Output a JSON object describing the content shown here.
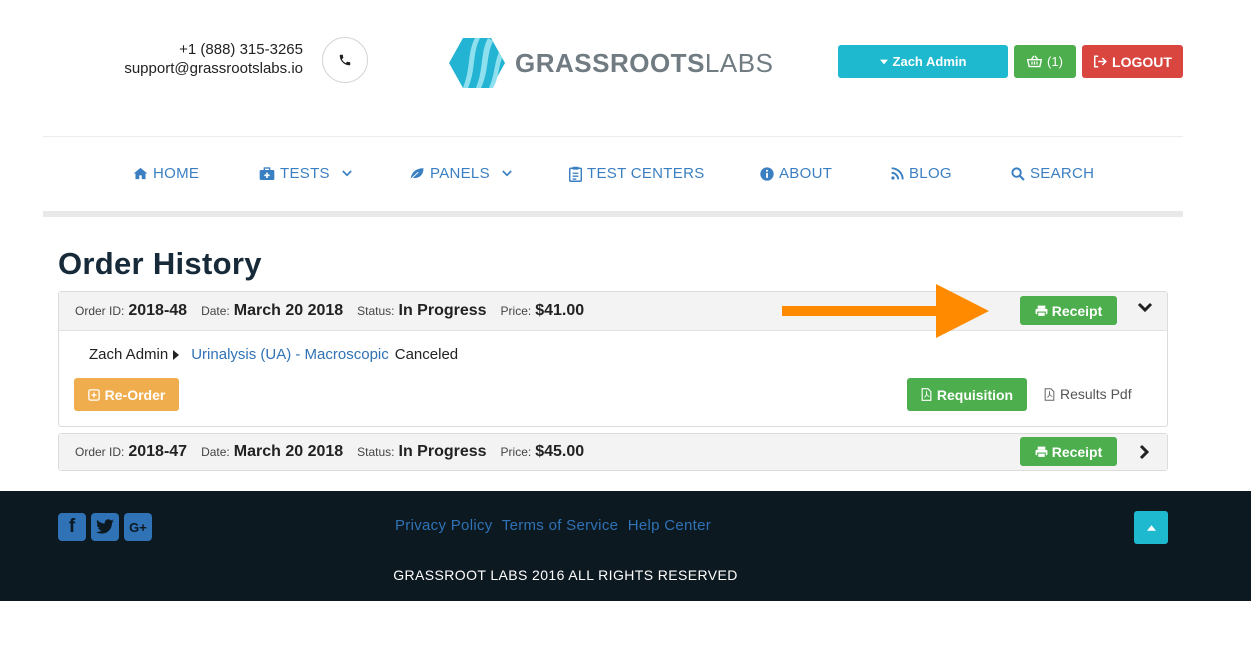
{
  "header": {
    "phone": "+1 (888) 315-3265",
    "email": "support@grassrootslabs.io",
    "logo_bold": "GRASSROOTS",
    "logo_light": "LABS",
    "admin_label": "Zach Admin",
    "cart_label": "(1)",
    "logout_label": "LOGOUT"
  },
  "nav": {
    "items": [
      {
        "label": "HOME",
        "icon": "home-icon"
      },
      {
        "label": "TESTS",
        "icon": "medkit-icon"
      },
      {
        "label": "PANELS",
        "icon": "leaf-icon"
      },
      {
        "label": "TEST CENTERS",
        "icon": "clipboard-icon"
      },
      {
        "label": "ABOUT",
        "icon": "info-icon"
      },
      {
        "label": "BLOG",
        "icon": "rss-icon"
      },
      {
        "label": "SEARCH",
        "icon": "search-icon"
      }
    ]
  },
  "page": {
    "title": "Order History"
  },
  "labels": {
    "order_id": "Order ID:",
    "date": "Date:",
    "status": "Status:",
    "price": "Price:",
    "receipt": "Receipt",
    "reorder": "Re-Order",
    "requisition": "Requisition",
    "results_pdf": "Results Pdf"
  },
  "orders": [
    {
      "id": "2018-48",
      "date": "March 20 2018",
      "status": "In Progress",
      "price": "$41.00",
      "expanded": true,
      "item": {
        "patient": "Zach Admin",
        "test": "Urinalysis (UA) - Macroscopic",
        "item_status": "Canceled"
      }
    },
    {
      "id": "2018-47",
      "date": "March 20 2018",
      "status": "In Progress",
      "price": "$45.00",
      "expanded": false
    }
  ],
  "footer": {
    "links": [
      "Privacy Policy",
      "Terms of Service",
      "Help Center"
    ],
    "copyright": "GRASSROOT LABS 2016 ALL RIGHTS RESERVED"
  },
  "colors": {
    "accent": "#1eb8cf",
    "success": "#4cae4c",
    "danger": "#d9463f",
    "warning": "#f0ad4e",
    "link": "#2f72b5",
    "footer_bg": "#0d1921",
    "annotation_arrow": "#ff8a00"
  }
}
